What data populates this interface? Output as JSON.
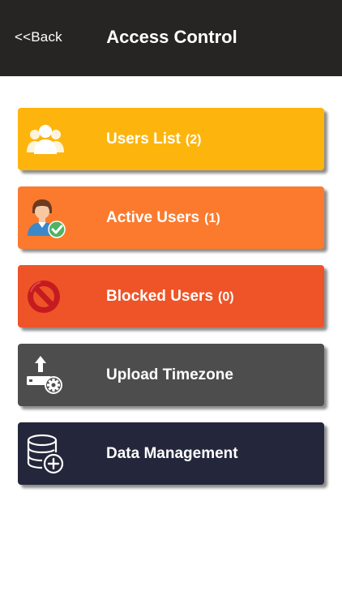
{
  "header": {
    "back_label": "<<Back",
    "title": "Access Control"
  },
  "menu": {
    "items": [
      {
        "label": "Users List",
        "count": "(2)",
        "icon": "users-group-icon",
        "color": "#FDB50E"
      },
      {
        "label": "Active Users",
        "count": "(1)",
        "icon": "user-check-icon",
        "color": "#FB7A2E"
      },
      {
        "label": "Blocked Users",
        "count": "(0)",
        "icon": "blocked-icon",
        "color": "#EE5427"
      },
      {
        "label": "Upload Timezone",
        "count": "",
        "icon": "upload-settings-icon",
        "color": "#4D4D4D"
      },
      {
        "label": "Data Management",
        "count": "",
        "icon": "database-add-icon",
        "color": "#24273B"
      }
    ]
  }
}
